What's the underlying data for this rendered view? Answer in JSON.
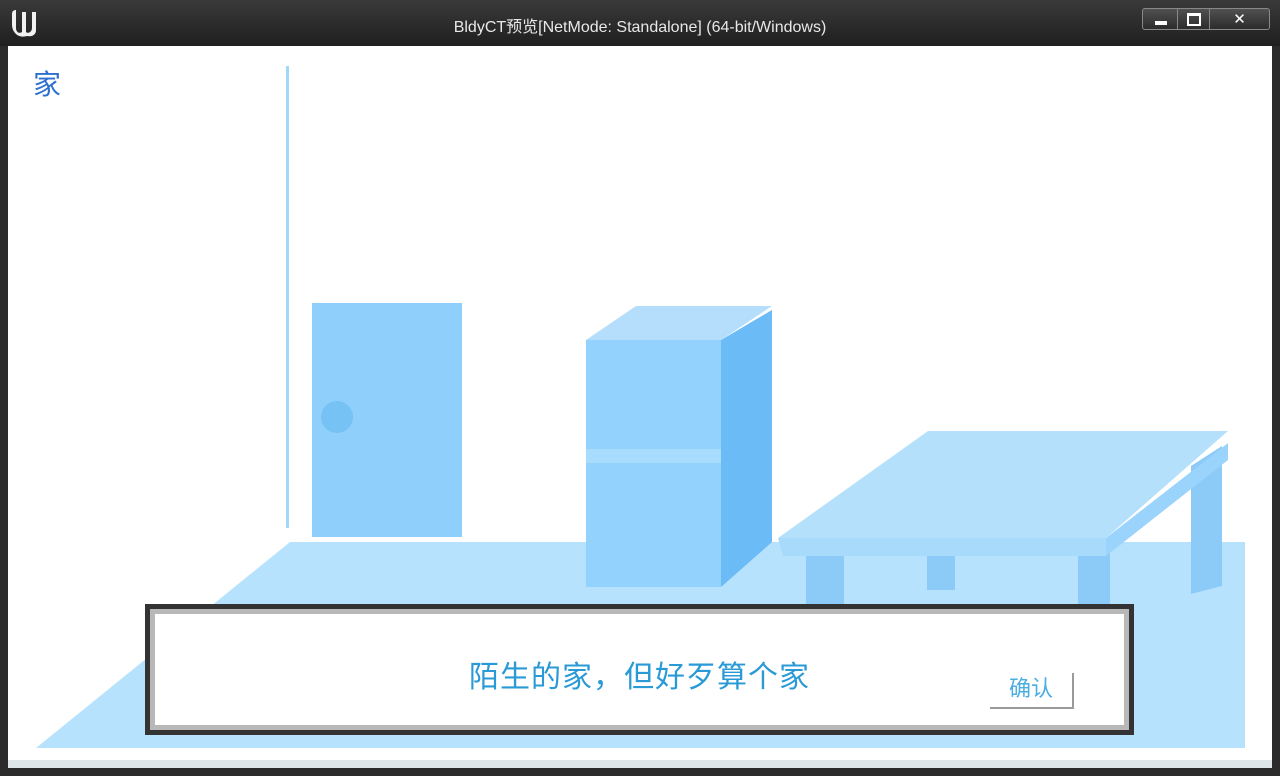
{
  "window": {
    "title": "BldyCT预览[NetMode: Standalone]  (64-bit/Windows)"
  },
  "scene": {
    "location_label": "家",
    "colors": {
      "floor": "#b6e2fd",
      "door": "#8ecffb",
      "fridge_front": "#93d2fd",
      "fridge_side": "#6bbbf7",
      "fridge_top": "#b4defc",
      "table_top": "#b4e0fc",
      "table_legs": "#8ccbf8",
      "wall_line": "#9fd8f8",
      "label_color": "#2d6fd1"
    }
  },
  "dialog": {
    "message": "陌生的家，但好歹算个家",
    "confirm_label": "确认",
    "text_color": "#2a9ad6"
  }
}
